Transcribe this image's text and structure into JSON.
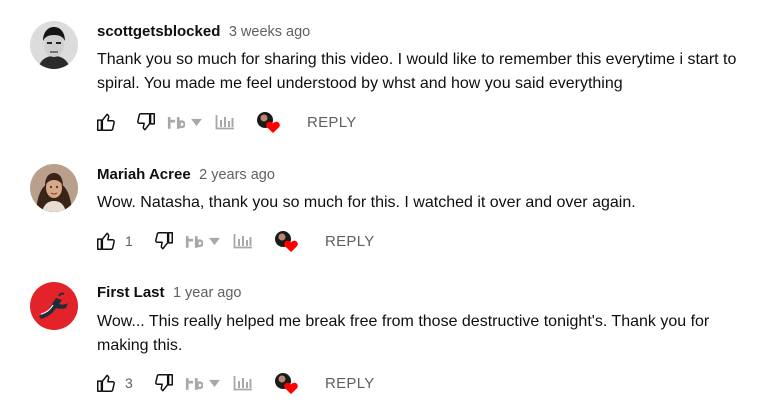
{
  "comments": [
    {
      "author": "scottgetsblocked",
      "time": "3 weeks ago",
      "text": "Thank you so much for sharing this video.  I would like to remember this everytime i start to spiral. You made me feel understood by whst and how you said everything",
      "likes": "",
      "reply_label": "REPLY"
    },
    {
      "author": "Mariah Acree",
      "time": "2 years ago",
      "text": "Wow. Natasha, thank you so much for this. I watched it over and over again.",
      "likes": "1",
      "reply_label": "REPLY"
    },
    {
      "author": "First Last",
      "time": "1 year ago",
      "text": "Wow... This really helped me break free from those destructive tonight's.  Thank you for making this.",
      "likes": "3",
      "reply_label": "REPLY"
    }
  ],
  "icons": {
    "like": "thumbs-up-icon",
    "dislike": "thumbs-down-icon",
    "tubebuddy": "tubebuddy-icon",
    "dropdown": "caret-down-icon",
    "stats": "bar-chart-icon",
    "heart": "creator-heart-icon"
  },
  "colors": {
    "heart": "#ff0000",
    "avatar_red": "#e2232a",
    "meta": "#606060",
    "icon_gray": "#a8a8a8"
  }
}
